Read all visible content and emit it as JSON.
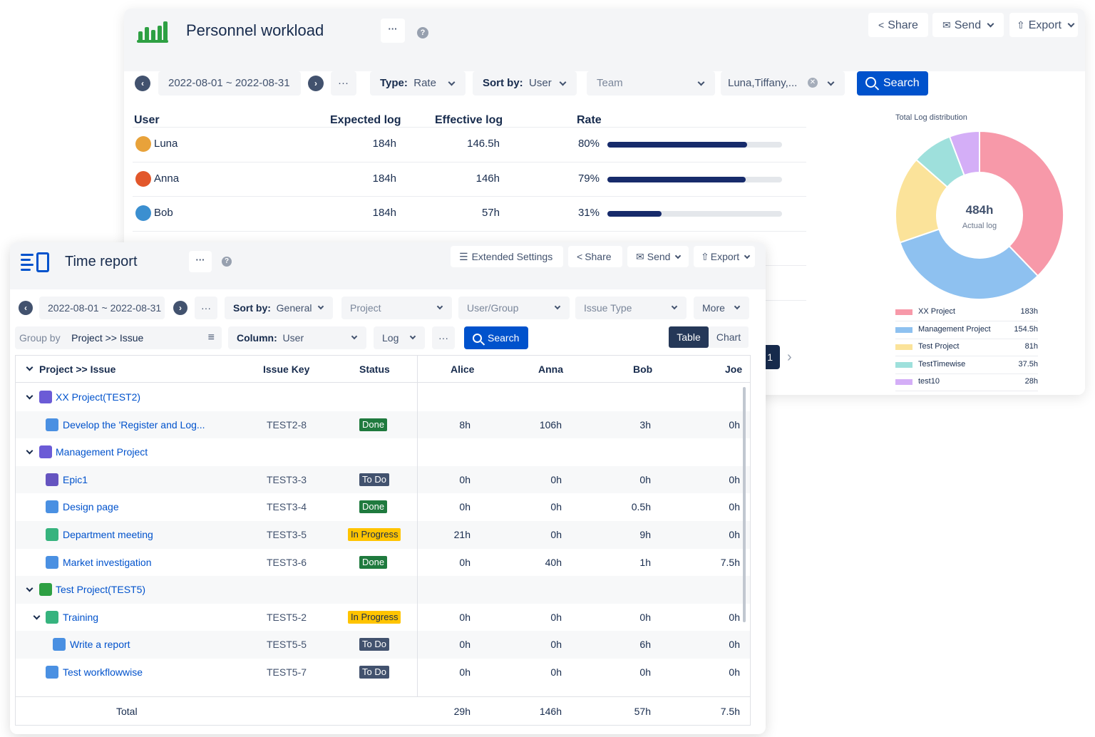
{
  "workload": {
    "title": "Personnel workload",
    "more_label": "···",
    "help_label": "?",
    "share_label": "Share",
    "send_label": "Send",
    "export_label": "Export",
    "date_range": "2022-08-01 ~ 2022-08-31",
    "prev_label": "‹",
    "next_label": "›",
    "type_label": "Type:",
    "type_value": "Rate",
    "sort_label": "Sort by:",
    "sort_value": "User",
    "team_placeholder": "Team",
    "users_value": "Luna,Tiffany,...",
    "search_label": "Search",
    "columns": {
      "user": "User",
      "expected": "Expected log",
      "effective": "Effective log",
      "rate": "Rate"
    },
    "rows": [
      {
        "user": "Luna",
        "expected": "184h",
        "effective": "146.5h",
        "rate_text": "80%",
        "rate": 0.8,
        "avatar_color": "#e8a23a"
      },
      {
        "user": "Anna",
        "expected": "184h",
        "effective": "146h",
        "rate_text": "79%",
        "rate": 0.79,
        "avatar_color": "#e2572b"
      },
      {
        "user": "Bob",
        "expected": "184h",
        "effective": "57h",
        "rate_text": "31%",
        "rate": 0.31,
        "avatar_color": "#3b8fd0"
      }
    ],
    "page_number": "1",
    "page_next": "›",
    "distribution": {
      "title": "Total Log distribution",
      "center_value": "484h",
      "center_label": "Actual log",
      "items": [
        {
          "name": "XX Project",
          "value_text": "183h",
          "value": 183,
          "color": "#f799a9"
        },
        {
          "name": "Management Project",
          "value_text": "154.5h",
          "value": 154.5,
          "color": "#8ec1f0"
        },
        {
          "name": "Test Project",
          "value_text": "81h",
          "value": 81,
          "color": "#fbe39a"
        },
        {
          "name": "TestTimewise",
          "value_text": "37.5h",
          "value": 37.5,
          "color": "#9ee0dc"
        },
        {
          "name": "test10",
          "value_text": "28h",
          "value": 28,
          "color": "#d4aef7"
        }
      ]
    }
  },
  "time_report": {
    "title": "Time report",
    "more_label": "···",
    "help_label": "?",
    "extended_settings_label": "Extended Settings",
    "share_label": "Share",
    "send_label": "Send",
    "export_label": "Export",
    "date_range": "2022-08-01 ~ 2022-08-31",
    "prev_label": "‹",
    "next_label": "›",
    "sort_label": "Sort by:",
    "sort_value": "General",
    "project_placeholder": "Project",
    "usergroup_placeholder": "User/Group",
    "issuetype_placeholder": "Issue Type",
    "more_filter_label": "More",
    "groupby_label": "Group by",
    "groupby_value": "Project >> Issue",
    "column_label": "Column:",
    "column_value": "User",
    "log_label": "Log",
    "search_label": "Search",
    "table_toggle": "Table",
    "chart_toggle": "Chart",
    "columns": {
      "project_issue": "Project >> Issue",
      "issue_key": "Issue Key",
      "status": "Status",
      "alice": "Alice",
      "anna": "Anna",
      "bob": "Bob",
      "joe": "Joe"
    },
    "rows": [
      {
        "kind": "project",
        "name": "XX Project(TEST2)",
        "icon_color": "#6b5bd6"
      },
      {
        "kind": "issue",
        "name": "Develop the 'Register and Log...",
        "key": "TEST2-8",
        "status": "Done",
        "alice": "8h",
        "anna": "106h",
        "bob": "3h",
        "joe": "0h",
        "icon_color": "#4a90e2"
      },
      {
        "kind": "project",
        "name": "Management Project",
        "icon_color": "#6b5bd6"
      },
      {
        "kind": "issue",
        "name": "Epic1",
        "key": "TEST3-3",
        "status": "To Do",
        "alice": "0h",
        "anna": "0h",
        "bob": "0h",
        "joe": "0h",
        "icon_color": "#6554c0"
      },
      {
        "kind": "issue",
        "name": "Design page",
        "key": "TEST3-4",
        "status": "Done",
        "alice": "0h",
        "anna": "0h",
        "bob": "0.5h",
        "joe": "0h",
        "icon_color": "#4a90e2"
      },
      {
        "kind": "issue",
        "name": "Department meeting",
        "key": "TEST3-5",
        "status": "In Progress",
        "alice": "21h",
        "anna": "0h",
        "bob": "9h",
        "joe": "0h",
        "icon_color": "#36b37e"
      },
      {
        "kind": "issue",
        "name": "Market investigation",
        "key": "TEST3-6",
        "status": "Done",
        "alice": "0h",
        "anna": "40h",
        "bob": "1h",
        "joe": "7.5h",
        "icon_color": "#4a90e2"
      },
      {
        "kind": "project",
        "name": "Test Project(TEST5)",
        "icon_color": "#2ea043"
      },
      {
        "kind": "issue-parent",
        "name": "Training",
        "key": "TEST5-2",
        "status": "In Progress",
        "alice": "0h",
        "anna": "0h",
        "bob": "0h",
        "joe": "0h",
        "icon_color": "#36b37e"
      },
      {
        "kind": "subtask",
        "name": "Write a report",
        "key": "TEST5-5",
        "status": "To Do",
        "alice": "0h",
        "anna": "0h",
        "bob": "6h",
        "joe": "0h",
        "icon_color": "#4a90e2"
      },
      {
        "kind": "issue",
        "name": "Test workflowwise",
        "key": "TEST5-7",
        "status": "To Do",
        "alice": "0h",
        "anna": "0h",
        "bob": "0h",
        "joe": "0h",
        "icon_color": "#4a90e2"
      }
    ],
    "total": {
      "label": "Total",
      "alice": "29h",
      "anna": "146h",
      "bob": "57h",
      "joe": "7.5h"
    }
  }
}
